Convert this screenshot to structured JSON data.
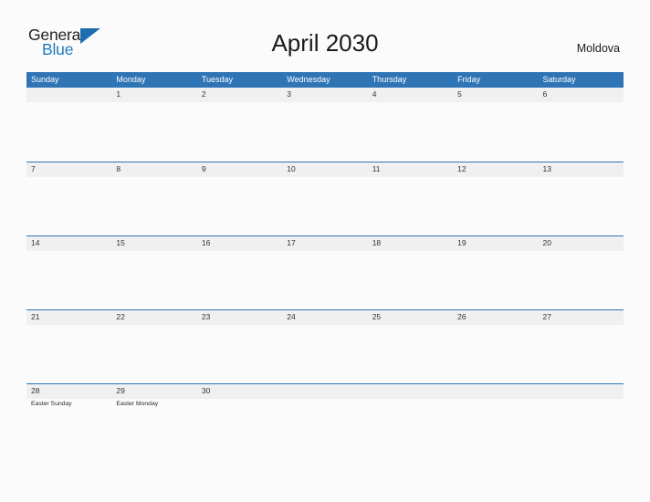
{
  "brand": {
    "name_part1": "General",
    "name_part2": "Blue",
    "flag_icon": "flag-triangle-icon",
    "accent_color": "#1f7ac0"
  },
  "header": {
    "title": "April 2030",
    "country": "Moldova"
  },
  "theme": {
    "header_blue": "#2f75b5",
    "number_band_gray": "#f0f0f0",
    "page_background": "#fbfbfc",
    "text_dark": "#333333"
  },
  "calendar": {
    "month": "April",
    "year": "2030",
    "weekday_headers": [
      "Sunday",
      "Monday",
      "Tuesday",
      "Wednesday",
      "Thursday",
      "Friday",
      "Saturday"
    ],
    "weeks": [
      {
        "days": [
          {
            "num": "",
            "events": []
          },
          {
            "num": "1",
            "events": []
          },
          {
            "num": "2",
            "events": []
          },
          {
            "num": "3",
            "events": []
          },
          {
            "num": "4",
            "events": []
          },
          {
            "num": "5",
            "events": []
          },
          {
            "num": "6",
            "events": []
          }
        ]
      },
      {
        "days": [
          {
            "num": "7",
            "events": []
          },
          {
            "num": "8",
            "events": []
          },
          {
            "num": "9",
            "events": []
          },
          {
            "num": "10",
            "events": []
          },
          {
            "num": "11",
            "events": []
          },
          {
            "num": "12",
            "events": []
          },
          {
            "num": "13",
            "events": []
          }
        ]
      },
      {
        "days": [
          {
            "num": "14",
            "events": []
          },
          {
            "num": "15",
            "events": []
          },
          {
            "num": "16",
            "events": []
          },
          {
            "num": "17",
            "events": []
          },
          {
            "num": "18",
            "events": []
          },
          {
            "num": "19",
            "events": []
          },
          {
            "num": "20",
            "events": []
          }
        ]
      },
      {
        "days": [
          {
            "num": "21",
            "events": []
          },
          {
            "num": "22",
            "events": []
          },
          {
            "num": "23",
            "events": []
          },
          {
            "num": "24",
            "events": []
          },
          {
            "num": "25",
            "events": []
          },
          {
            "num": "26",
            "events": []
          },
          {
            "num": "27",
            "events": []
          }
        ]
      },
      {
        "days": [
          {
            "num": "28",
            "events": [
              "Easter Sunday"
            ]
          },
          {
            "num": "29",
            "events": [
              "Easter Monday"
            ]
          },
          {
            "num": "30",
            "events": []
          },
          {
            "num": "",
            "events": []
          },
          {
            "num": "",
            "events": []
          },
          {
            "num": "",
            "events": []
          },
          {
            "num": "",
            "events": []
          }
        ]
      }
    ]
  }
}
